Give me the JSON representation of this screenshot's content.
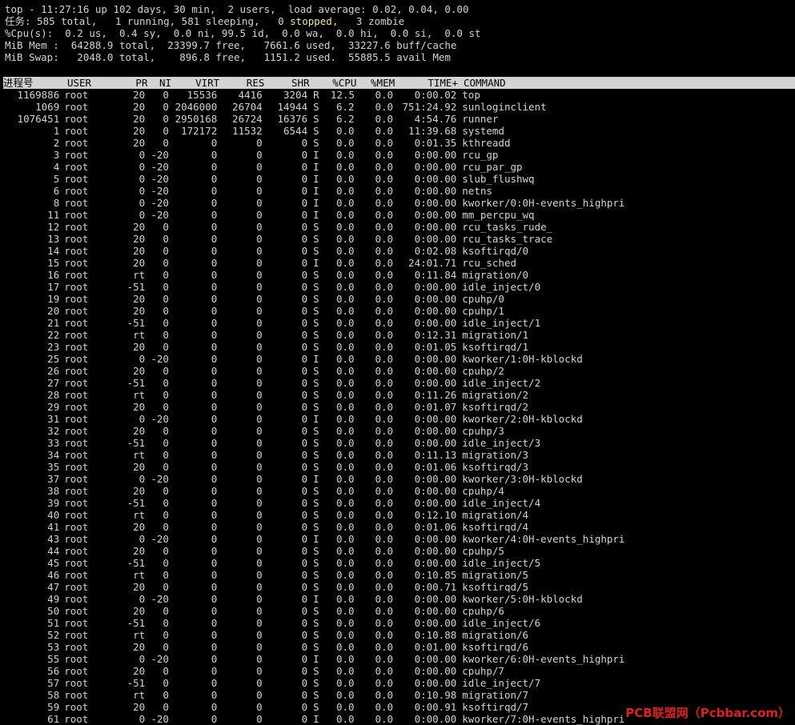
{
  "summary": {
    "line1": "top - 11:27:16 up 102 days, 30 min,  2 users,  load average: 0.02, 0.04, 0.00",
    "line2_before": "任务: 585 total,   1 running, 581 sleeping,   0 ",
    "line2_highlight": "stopped",
    "line2_after": ",   3 zombie",
    "line3": "%Cpu(s):  0.2 us,  0.4 sy,  0.0 ni, 99.5 id,  0.0 wa,  0.0 hi,  0.0 si,  0.0 st",
    "line4": "MiB Mem :  64288.9 total,  23399.7 free,   7661.6 used,  33227.6 buff/cache",
    "line5": "MiB Swap:   2048.0 total,    896.8 free,   1151.2 used.  55885.5 avail Mem"
  },
  "table": {
    "headers": [
      "进程号",
      "USER",
      "PR",
      "NI",
      "VIRT",
      "RES",
      "SHR",
      "",
      "%CPU",
      "%MEM",
      "TIME+",
      "COMMAND"
    ],
    "rows": [
      [
        "1169886",
        "root",
        "20",
        "0",
        "15536",
        "4416",
        "3204",
        "R",
        "12.5",
        "0.0",
        "0:00.02",
        "top"
      ],
      [
        "1069",
        "root",
        "20",
        "0",
        "2046000",
        "26704",
        "14944",
        "S",
        "6.2",
        "0.0",
        "751:24.92",
        "sunloginclient"
      ],
      [
        "1076451",
        "root",
        "20",
        "0",
        "2950168",
        "26724",
        "16376",
        "S",
        "6.2",
        "0.0",
        "4:54.76",
        "runner"
      ],
      [
        "1",
        "root",
        "20",
        "0",
        "172172",
        "11532",
        "6544",
        "S",
        "0.0",
        "0.0",
        "11:39.68",
        "systemd"
      ],
      [
        "2",
        "root",
        "20",
        "0",
        "0",
        "0",
        "0",
        "S",
        "0.0",
        "0.0",
        "0:01.35",
        "kthreadd"
      ],
      [
        "3",
        "root",
        "0",
        "-20",
        "0",
        "0",
        "0",
        "I",
        "0.0",
        "0.0",
        "0:00.00",
        "rcu_gp"
      ],
      [
        "4",
        "root",
        "0",
        "-20",
        "0",
        "0",
        "0",
        "I",
        "0.0",
        "0.0",
        "0:00.00",
        "rcu_par_gp"
      ],
      [
        "5",
        "root",
        "0",
        "-20",
        "0",
        "0",
        "0",
        "I",
        "0.0",
        "0.0",
        "0:00.00",
        "slub_flushwq"
      ],
      [
        "6",
        "root",
        "0",
        "-20",
        "0",
        "0",
        "0",
        "I",
        "0.0",
        "0.0",
        "0:00.00",
        "netns"
      ],
      [
        "8",
        "root",
        "0",
        "-20",
        "0",
        "0",
        "0",
        "I",
        "0.0",
        "0.0",
        "0:00.00",
        "kworker/0:0H-events_highpri"
      ],
      [
        "11",
        "root",
        "0",
        "-20",
        "0",
        "0",
        "0",
        "I",
        "0.0",
        "0.0",
        "0:00.00",
        "mm_percpu_wq"
      ],
      [
        "12",
        "root",
        "20",
        "0",
        "0",
        "0",
        "0",
        "S",
        "0.0",
        "0.0",
        "0:00.00",
        "rcu_tasks_rude_"
      ],
      [
        "13",
        "root",
        "20",
        "0",
        "0",
        "0",
        "0",
        "S",
        "0.0",
        "0.0",
        "0:00.00",
        "rcu_tasks_trace"
      ],
      [
        "14",
        "root",
        "20",
        "0",
        "0",
        "0",
        "0",
        "S",
        "0.0",
        "0.0",
        "0:02.08",
        "ksoftirqd/0"
      ],
      [
        "15",
        "root",
        "20",
        "0",
        "0",
        "0",
        "0",
        "I",
        "0.0",
        "0.0",
        "24:01.71",
        "rcu_sched"
      ],
      [
        "16",
        "root",
        "rt",
        "0",
        "0",
        "0",
        "0",
        "S",
        "0.0",
        "0.0",
        "0:11.84",
        "migration/0"
      ],
      [
        "17",
        "root",
        "-51",
        "0",
        "0",
        "0",
        "0",
        "S",
        "0.0",
        "0.0",
        "0:00.00",
        "idle_inject/0"
      ],
      [
        "19",
        "root",
        "20",
        "0",
        "0",
        "0",
        "0",
        "S",
        "0.0",
        "0.0",
        "0:00.00",
        "cpuhp/0"
      ],
      [
        "20",
        "root",
        "20",
        "0",
        "0",
        "0",
        "0",
        "S",
        "0.0",
        "0.0",
        "0:00.00",
        "cpuhp/1"
      ],
      [
        "21",
        "root",
        "-51",
        "0",
        "0",
        "0",
        "0",
        "S",
        "0.0",
        "0.0",
        "0:00.00",
        "idle_inject/1"
      ],
      [
        "22",
        "root",
        "rt",
        "0",
        "0",
        "0",
        "0",
        "S",
        "0.0",
        "0.0",
        "0:12.31",
        "migration/1"
      ],
      [
        "23",
        "root",
        "20",
        "0",
        "0",
        "0",
        "0",
        "S",
        "0.0",
        "0.0",
        "0:01.05",
        "ksoftirqd/1"
      ],
      [
        "25",
        "root",
        "0",
        "-20",
        "0",
        "0",
        "0",
        "I",
        "0.0",
        "0.0",
        "0:00.00",
        "kworker/1:0H-kblockd"
      ],
      [
        "26",
        "root",
        "20",
        "0",
        "0",
        "0",
        "0",
        "S",
        "0.0",
        "0.0",
        "0:00.00",
        "cpuhp/2"
      ],
      [
        "27",
        "root",
        "-51",
        "0",
        "0",
        "0",
        "0",
        "S",
        "0.0",
        "0.0",
        "0:00.00",
        "idle_inject/2"
      ],
      [
        "28",
        "root",
        "rt",
        "0",
        "0",
        "0",
        "0",
        "S",
        "0.0",
        "0.0",
        "0:11.26",
        "migration/2"
      ],
      [
        "29",
        "root",
        "20",
        "0",
        "0",
        "0",
        "0",
        "S",
        "0.0",
        "0.0",
        "0:01.07",
        "ksoftirqd/2"
      ],
      [
        "31",
        "root",
        "0",
        "-20",
        "0",
        "0",
        "0",
        "I",
        "0.0",
        "0.0",
        "0:00.00",
        "kworker/2:0H-kblockd"
      ],
      [
        "32",
        "root",
        "20",
        "0",
        "0",
        "0",
        "0",
        "S",
        "0.0",
        "0.0",
        "0:00.00",
        "cpuhp/3"
      ],
      [
        "33",
        "root",
        "-51",
        "0",
        "0",
        "0",
        "0",
        "S",
        "0.0",
        "0.0",
        "0:00.00",
        "idle_inject/3"
      ],
      [
        "34",
        "root",
        "rt",
        "0",
        "0",
        "0",
        "0",
        "S",
        "0.0",
        "0.0",
        "0:11.13",
        "migration/3"
      ],
      [
        "35",
        "root",
        "20",
        "0",
        "0",
        "0",
        "0",
        "S",
        "0.0",
        "0.0",
        "0:01.06",
        "ksoftirqd/3"
      ],
      [
        "37",
        "root",
        "0",
        "-20",
        "0",
        "0",
        "0",
        "I",
        "0.0",
        "0.0",
        "0:00.00",
        "kworker/3:0H-kblockd"
      ],
      [
        "38",
        "root",
        "20",
        "0",
        "0",
        "0",
        "0",
        "S",
        "0.0",
        "0.0",
        "0:00.00",
        "cpuhp/4"
      ],
      [
        "39",
        "root",
        "-51",
        "0",
        "0",
        "0",
        "0",
        "S",
        "0.0",
        "0.0",
        "0:00.00",
        "idle_inject/4"
      ],
      [
        "40",
        "root",
        "rt",
        "0",
        "0",
        "0",
        "0",
        "S",
        "0.0",
        "0.0",
        "0:12.10",
        "migration/4"
      ],
      [
        "41",
        "root",
        "20",
        "0",
        "0",
        "0",
        "0",
        "S",
        "0.0",
        "0.0",
        "0:01.06",
        "ksoftirqd/4"
      ],
      [
        "43",
        "root",
        "0",
        "-20",
        "0",
        "0",
        "0",
        "I",
        "0.0",
        "0.0",
        "0:00.00",
        "kworker/4:0H-events_highpri"
      ],
      [
        "44",
        "root",
        "20",
        "0",
        "0",
        "0",
        "0",
        "S",
        "0.0",
        "0.0",
        "0:00.00",
        "cpuhp/5"
      ],
      [
        "45",
        "root",
        "-51",
        "0",
        "0",
        "0",
        "0",
        "S",
        "0.0",
        "0.0",
        "0:00.00",
        "idle_inject/5"
      ],
      [
        "46",
        "root",
        "rt",
        "0",
        "0",
        "0",
        "0",
        "S",
        "0.0",
        "0.0",
        "0:10.85",
        "migration/5"
      ],
      [
        "47",
        "root",
        "20",
        "0",
        "0",
        "0",
        "0",
        "S",
        "0.0",
        "0.0",
        "0:00.71",
        "ksoftirqd/5"
      ],
      [
        "49",
        "root",
        "0",
        "-20",
        "0",
        "0",
        "0",
        "I",
        "0.0",
        "0.0",
        "0:00.00",
        "kworker/5:0H-kblockd"
      ],
      [
        "50",
        "root",
        "20",
        "0",
        "0",
        "0",
        "0",
        "S",
        "0.0",
        "0.0",
        "0:00.00",
        "cpuhp/6"
      ],
      [
        "51",
        "root",
        "-51",
        "0",
        "0",
        "0",
        "0",
        "S",
        "0.0",
        "0.0",
        "0:00.00",
        "idle_inject/6"
      ],
      [
        "52",
        "root",
        "rt",
        "0",
        "0",
        "0",
        "0",
        "S",
        "0.0",
        "0.0",
        "0:10.88",
        "migration/6"
      ],
      [
        "53",
        "root",
        "20",
        "0",
        "0",
        "0",
        "0",
        "S",
        "0.0",
        "0.0",
        "0:01.00",
        "ksoftirqd/6"
      ],
      [
        "55",
        "root",
        "0",
        "-20",
        "0",
        "0",
        "0",
        "I",
        "0.0",
        "0.0",
        "0:00.00",
        "kworker/6:0H-events_highpri"
      ],
      [
        "56",
        "root",
        "20",
        "0",
        "0",
        "0",
        "0",
        "S",
        "0.0",
        "0.0",
        "0:00.00",
        "cpuhp/7"
      ],
      [
        "57",
        "root",
        "-51",
        "0",
        "0",
        "0",
        "0",
        "S",
        "0.0",
        "0.0",
        "0:00.00",
        "idle_inject/7"
      ],
      [
        "58",
        "root",
        "rt",
        "0",
        "0",
        "0",
        "0",
        "S",
        "0.0",
        "0.0",
        "0:10.98",
        "migration/7"
      ],
      [
        "59",
        "root",
        "20",
        "0",
        "0",
        "0",
        "0",
        "S",
        "0.0",
        "0.0",
        "0:00.91",
        "ksoftirqd/7"
      ],
      [
        "61",
        "root",
        "0",
        "-20",
        "0",
        "0",
        "0",
        "I",
        "0.0",
        "0.0",
        "0:00.00",
        "kworker/7:0H-events_highpri"
      ]
    ]
  },
  "watermark": "PCB联盟网（Pcbbar.com）",
  "colors": {
    "background": "#000000",
    "text": "#d3d3d3",
    "header_bg": "#d3d3d3",
    "header_text": "#000000",
    "highlight": "#f0e68c",
    "watermark": "#e02020"
  }
}
